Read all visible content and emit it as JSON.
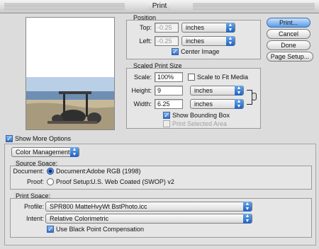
{
  "window": {
    "title": "Print"
  },
  "position": {
    "legend": "Position",
    "top_label": "Top:",
    "top_value": "-0.25",
    "top_unit": "inches",
    "left_label": "Left:",
    "left_value": "-0.25",
    "left_unit": "inches",
    "center_image": "Center Image"
  },
  "scaled": {
    "legend": "Scaled Print Size",
    "scale_label": "Scale:",
    "scale_value": "100%",
    "fit_media": "Scale to Fit Media",
    "height_label": "Height:",
    "height_value": "9",
    "height_unit": "inches",
    "width_label": "Width:",
    "width_value": "6.25",
    "width_unit": "inches",
    "show_bounding_box": "Show Bounding Box",
    "print_selected_area": "Print Selected Area"
  },
  "buttons": {
    "print": "Print...",
    "cancel": "Cancel",
    "done": "Done",
    "page_setup": "Page Setup..."
  },
  "more": {
    "show_more_options": "Show More Options",
    "section_popup": "Color Management"
  },
  "source": {
    "legend": "Source Space:",
    "document_label": "Document:",
    "document_option": "Document:",
    "document_value": "Adobe RGB (1998)",
    "proof_label": "Proof:",
    "proof_option": "Proof Setup:",
    "proof_value": "U.S. Web Coated (SWOP) v2"
  },
  "print_space": {
    "legend": "Print Space:",
    "profile_label": "Profile:",
    "profile_value": "SPR800 MatteHvyWt BstPhoto.icc",
    "intent_label": "Intent:",
    "intent_value": "Relative Colorimetric",
    "bpc": "Use Black Point Compensation"
  },
  "icons": {
    "link": "chain-link-icon",
    "popup_arrows": "popup-arrows-icon"
  }
}
